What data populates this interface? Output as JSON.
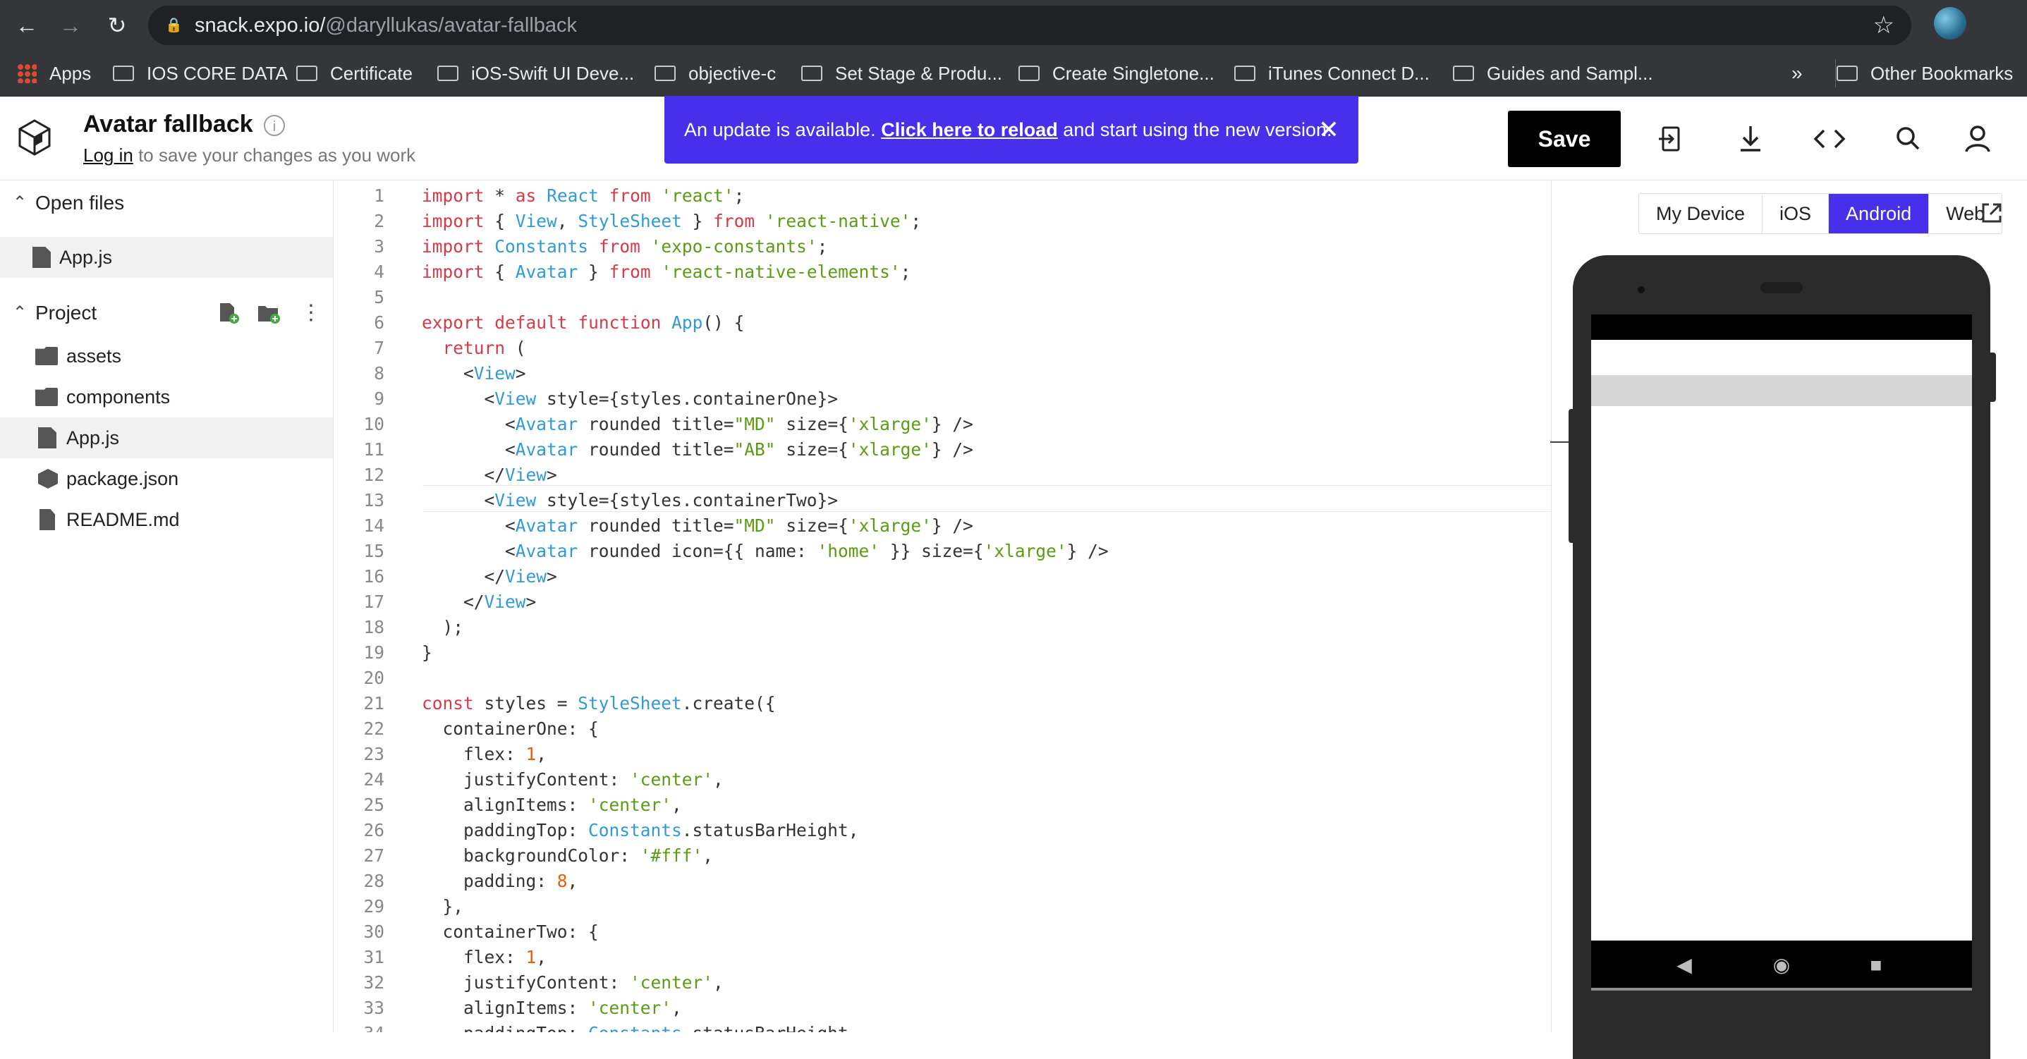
{
  "browser": {
    "url_host": "snack.expo.io/",
    "url_path": "@daryllukas/avatar-fallback",
    "bookmarks": [
      "Apps",
      "IOS CORE DATA",
      "Certificate",
      "iOS-Swift UI Deve...",
      "objective-c",
      "Set Stage & Produ...",
      "Create Singletone...",
      "iTunes Connect D...",
      "Guides and Sampl..."
    ],
    "overflow": "»",
    "other_bookmarks": "Other Bookmarks"
  },
  "header": {
    "title": "Avatar fallback",
    "login_link": "Log in",
    "login_rest": " to save your changes as you work",
    "save_label": "Save"
  },
  "banner": {
    "prefix": "An update is available. ",
    "link": "Click here to reload",
    "suffix": " and start using the new version."
  },
  "sidebar": {
    "open_files_label": "Open files",
    "open_files": [
      "App.js"
    ],
    "project_label": "Project",
    "project_items": [
      "assets",
      "components",
      "App.js",
      "package.json",
      "README.md"
    ]
  },
  "editor": {
    "line_numbers": [
      "1",
      "2",
      "3",
      "4",
      "5",
      "6",
      "7",
      "8",
      "9",
      "10",
      "11",
      "12",
      "13",
      "14",
      "15",
      "16",
      "17",
      "18",
      "19",
      "20",
      "21",
      "22",
      "23",
      "24",
      "25",
      "26",
      "27",
      "28",
      "29",
      "30",
      "31",
      "32",
      "33",
      "34"
    ],
    "lines": [
      "import * as React from 'react';",
      "import { View, StyleSheet } from 'react-native';",
      "import Constants from 'expo-constants';",
      "import { Avatar } from 'react-native-elements';",
      "",
      "export default function App() {",
      "  return (",
      "    <View>",
      "      <View style={styles.containerOne}>",
      "        <Avatar rounded title=\"MD\" size={'xlarge'} />",
      "        <Avatar rounded title=\"AB\" size={'xlarge'} />",
      "      </View>",
      "      <View style={styles.containerTwo}>",
      "        <Avatar rounded title=\"MD\" size={'xlarge'} />",
      "        <Avatar rounded icon={{ name: 'home' }} size={'xlarge'} />",
      "      </View>",
      "    </View>",
      "  );",
      "}",
      "",
      "const styles = StyleSheet.create({",
      "  containerOne: {",
      "    flex: 1,",
      "    justifyContent: 'center',",
      "    alignItems: 'center',",
      "    paddingTop: Constants.statusBarHeight,",
      "    backgroundColor: '#fff',",
      "    padding: 8,",
      "  },",
      "  containerTwo: {",
      "    flex: 1,",
      "    justifyContent: 'center',",
      "    alignItems: 'center',",
      "    paddingTop: Constants.statusBarHeight,"
    ]
  },
  "preview": {
    "tabs": [
      "My Device",
      "iOS",
      "Android",
      "Web"
    ],
    "active_tab": "Android"
  },
  "colors": {
    "accent": "#4630eb",
    "chrome": "#35363a"
  },
  "icons": [
    "back-arrow-icon",
    "forward-arrow-icon",
    "reload-icon",
    "lock-icon",
    "star-icon",
    "info-icon",
    "close-icon",
    "export-icon",
    "download-icon",
    "embed-code-icon",
    "search-icon",
    "user-icon",
    "add-file-icon",
    "add-folder-icon",
    "more-icon",
    "popout-icon"
  ]
}
